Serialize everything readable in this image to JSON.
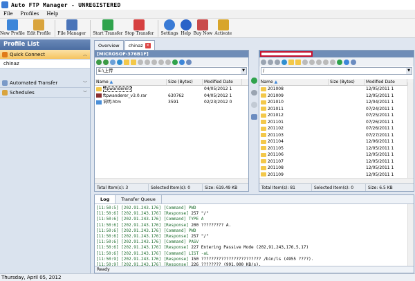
{
  "window": {
    "title": "Auto FTP Manager - UNREGISTERED"
  },
  "menu": [
    "File",
    "Profiles",
    "Help"
  ],
  "toolbar": [
    {
      "label": "New Profile",
      "color": "#3d86d9"
    },
    {
      "label": "Edit Profile",
      "color": "#d9a43d"
    },
    {
      "label": "File Manager",
      "color": "#4a74b8"
    },
    {
      "label": "Start Transfer",
      "color": "#2fa34c"
    },
    {
      "label": "Stop Transfer",
      "color": "#d64040"
    },
    {
      "label": "Settings",
      "color": "#3a7bd5"
    },
    {
      "label": "Help",
      "color": "#2a63c8"
    },
    {
      "label": "Buy Now",
      "color": "#c94a4a"
    },
    {
      "label": "Activate",
      "color": "#d8a52a"
    }
  ],
  "sidebar": {
    "title": "Profile List",
    "quick_connect": "Quick Connect",
    "profile": "chinaz",
    "automated": "Automated Transfer",
    "schedules": "Schedules"
  },
  "tabs": {
    "overview": "Overview",
    "chinaz": "chinaz"
  },
  "left_pane": {
    "header": "[MICROSOF-376B1F]",
    "path": "E:\\上传",
    "cols": [
      "Name",
      "Size (Bytes)",
      "Modified Date"
    ],
    "rows": [
      {
        "name": "ftpwanderer3",
        "size": "",
        "date": "04/05/2012 1",
        "type": "folder"
      },
      {
        "name": "ftpwanderer_v3.0.rar",
        "size": "630762",
        "date": "04/05/2012 1",
        "type": "file"
      },
      {
        "name": "说明.htm",
        "size": "3591",
        "date": "02/23/2012 0",
        "type": "htm"
      }
    ],
    "status": {
      "total": "Total Item(s): 3",
      "selected": "Selected Item(s): 0",
      "size": "Size: 619.49 KB"
    }
  },
  "right_pane": {
    "path": "/",
    "cols": [
      "Name",
      "Size (Bytes)",
      "Modified Date"
    ],
    "rows": [
      {
        "name": "201008",
        "size": "",
        "date": "12/05/2011 1"
      },
      {
        "name": "201009",
        "size": "",
        "date": "12/05/2011 1"
      },
      {
        "name": "201010",
        "size": "",
        "date": "12/04/2011 1"
      },
      {
        "name": "201011",
        "size": "",
        "date": "07/24/2011 1"
      },
      {
        "name": "201012",
        "size": "",
        "date": "07/25/2011 1"
      },
      {
        "name": "201101",
        "size": "",
        "date": "07/26/2011 1"
      },
      {
        "name": "201102",
        "size": "",
        "date": "07/26/2011 1"
      },
      {
        "name": "201103",
        "size": "",
        "date": "07/27/2011 1"
      },
      {
        "name": "201104",
        "size": "",
        "date": "12/06/2011 1"
      },
      {
        "name": "201105",
        "size": "",
        "date": "12/05/2011 1"
      },
      {
        "name": "201106",
        "size": "",
        "date": "12/05/2011 1"
      },
      {
        "name": "201107",
        "size": "",
        "date": "12/05/2011 1"
      },
      {
        "name": "201108",
        "size": "",
        "date": "12/05/2011 1"
      },
      {
        "name": "201109",
        "size": "",
        "date": "12/05/2011 1"
      }
    ],
    "status": {
      "total": "Total Item(s): 81",
      "selected": "Selected Item(s): 0",
      "size": "Size: 6.5 KB"
    }
  },
  "log": {
    "tabs": [
      "Log",
      "Transfer Queue"
    ],
    "lines": [
      {
        "t": "[11:50:5]",
        "ip": "[202.91.243.176]",
        "kind": "[Command]",
        "msg": "PWD"
      },
      {
        "t": "[11:50:6]",
        "ip": "[202.91.243.176]",
        "kind": "[Response]",
        "msg": "257 \"/\""
      },
      {
        "t": "[11:50:6]",
        "ip": "[202.91.243.176]",
        "kind": "[Command]",
        "msg": "TYPE A"
      },
      {
        "t": "[11:50:6]",
        "ip": "[202.91.243.176]",
        "kind": "[Response]",
        "msg": "200 ????????? A."
      },
      {
        "t": "[11:50:6]",
        "ip": "[202.91.243.176]",
        "kind": "[Command]",
        "msg": "PWD"
      },
      {
        "t": "[11:50:6]",
        "ip": "[202.91.243.176]",
        "kind": "[Response]",
        "msg": "257 \"/\""
      },
      {
        "t": "[11:50:6]",
        "ip": "[202.91.243.176]",
        "kind": "[Command]",
        "msg": "PASV"
      },
      {
        "t": "[11:50:6]",
        "ip": "[202.91.243.176]",
        "kind": "[Response]",
        "msg": "227 Entering Passive Mode (202,91,243,176,5,17)"
      },
      {
        "t": "[11:50:6]",
        "ip": "[202.91.243.176]",
        "kind": "[Command]",
        "msg": "LIST -aL"
      },
      {
        "t": "[11:50:9]",
        "ip": "[202.91.243.176]",
        "kind": "[Response]",
        "msg": "150 ???????????????????????? /bin/ls (4955 ????)."
      },
      {
        "t": "[11:50:9]",
        "ip": "[202.91.243.176]",
        "kind": "[Response]",
        "msg": "226 ???????? (991.000 KB/s)."
      }
    ],
    "ready": "Ready"
  },
  "statusbar": {
    "date": "Thursday, April 05, 2012"
  }
}
